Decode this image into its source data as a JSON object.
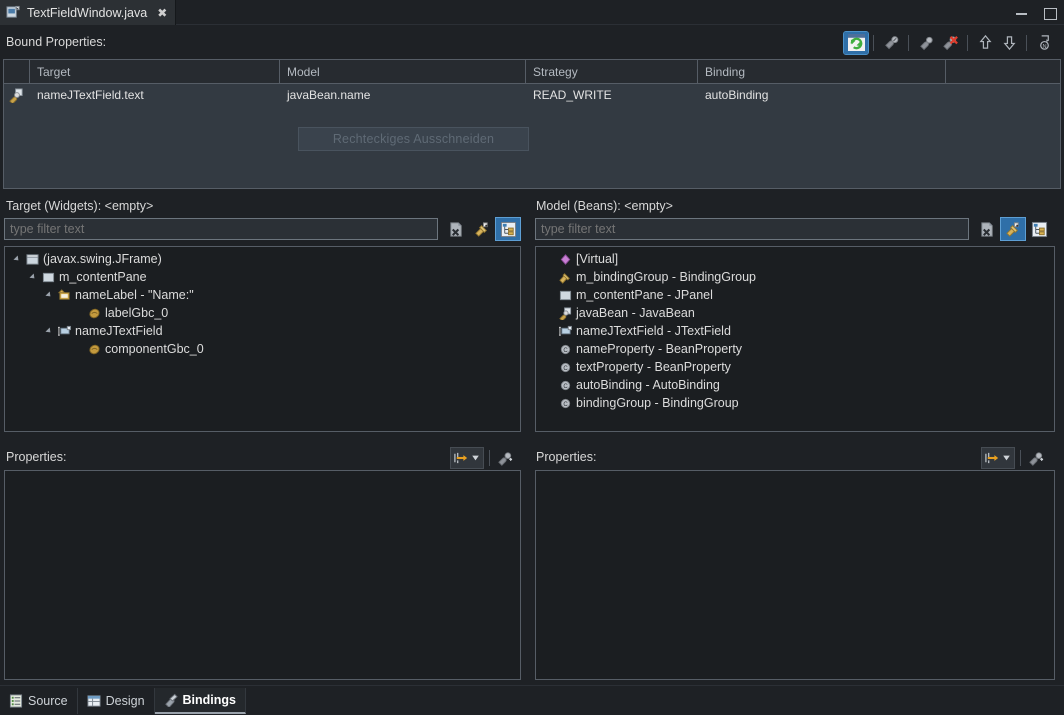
{
  "window": {
    "editor_tab_label": "TextFieldWindow.java",
    "tab_close_glyph": "✖",
    "minimize_label": "Minimize",
    "maximize_label": "Maximize"
  },
  "bound_properties": {
    "label": "Bound Properties:",
    "toolbar": [
      {
        "name": "refresh-bindings-button",
        "tooltip": "Refresh",
        "active": true
      },
      {
        "name": "edit-binding-button",
        "tooltip": "Edit Binding",
        "active": false
      },
      {
        "name": "add-binding-button",
        "tooltip": "Add Binding",
        "active": false
      },
      {
        "name": "delete-binding-button",
        "tooltip": "Delete Binding",
        "active": false
      },
      {
        "name": "move-up-button",
        "tooltip": "Move Up",
        "active": false
      },
      {
        "name": "move-down-button",
        "tooltip": "Move Down",
        "active": false
      },
      {
        "name": "goto-definition-button",
        "tooltip": "Go To Definition",
        "active": false
      }
    ],
    "columns": [
      "Target",
      "Model",
      "Strategy",
      "Binding"
    ],
    "rows": [
      {
        "icon": "binding-icon",
        "target": "nameJTextField.text",
        "model": "javaBean.name",
        "strategy": "READ_WRITE",
        "binding": "autoBinding"
      }
    ],
    "overlay_tooltip": "Rechteckiges Ausschneiden"
  },
  "target_panel": {
    "label": "Target (Widgets): <empty>",
    "filter": {
      "value": "type filter text",
      "placeholder": "type filter text"
    },
    "filter_buttons": [
      {
        "name": "clear-filter-icon",
        "selected": false
      },
      {
        "name": "show-properties-icon",
        "selected": false
      },
      {
        "name": "show-tree-icon",
        "selected": true
      }
    ],
    "tree": [
      {
        "indent": 0,
        "twisty": true,
        "icon": "frame-icon",
        "label": "(javax.swing.JFrame)"
      },
      {
        "indent": 1,
        "twisty": true,
        "icon": "panel-icon",
        "label": "m_contentPane"
      },
      {
        "indent": 2,
        "twisty": true,
        "icon": "label-icon",
        "label": "nameLabel - \"Name:\""
      },
      {
        "indent": 3,
        "twisty": false,
        "icon": "bean-icon",
        "label": "labelGbc_0"
      },
      {
        "indent": 2,
        "twisty": true,
        "icon": "textfield-icon",
        "label": "nameJTextField"
      },
      {
        "indent": 3,
        "twisty": false,
        "icon": "bean-icon",
        "label": "componentGbc_0"
      }
    ],
    "properties": {
      "label": "Properties:",
      "buttons": [
        {
          "name": "show-advanced-properties-icon",
          "dropdown": true
        },
        {
          "name": "goto-property-definition-icon",
          "dropdown": false
        }
      ],
      "rows": []
    }
  },
  "model_panel": {
    "label": "Model (Beans): <empty>",
    "filter": {
      "value": "type filter text",
      "placeholder": "type filter text"
    },
    "filter_buttons": [
      {
        "name": "clear-filter-icon",
        "selected": false
      },
      {
        "name": "show-properties-icon",
        "selected": true
      },
      {
        "name": "show-tree-icon",
        "selected": false
      }
    ],
    "tree": [
      {
        "indent": 0,
        "twisty": false,
        "icon": "virtual-icon",
        "label": "[Virtual]"
      },
      {
        "indent": 0,
        "twisty": false,
        "icon": "bindinggroup-icon",
        "label": "m_bindingGroup - BindingGroup"
      },
      {
        "indent": 0,
        "twisty": false,
        "icon": "panel-icon",
        "label": "m_contentPane - JPanel"
      },
      {
        "indent": 0,
        "twisty": false,
        "icon": "javabean-icon",
        "label": "javaBean - JavaBean"
      },
      {
        "indent": 0,
        "twisty": false,
        "icon": "textfield-icon",
        "label": "nameJTextField - JTextField"
      },
      {
        "indent": 0,
        "twisty": false,
        "icon": "property-icon",
        "label": "nameProperty - BeanProperty"
      },
      {
        "indent": 0,
        "twisty": false,
        "icon": "property-icon",
        "label": "textProperty - BeanProperty"
      },
      {
        "indent": 0,
        "twisty": false,
        "icon": "property-icon",
        "label": "autoBinding - AutoBinding"
      },
      {
        "indent": 0,
        "twisty": false,
        "icon": "property-icon",
        "label": "bindingGroup - BindingGroup"
      }
    ],
    "properties": {
      "label": "Properties:",
      "buttons": [
        {
          "name": "show-advanced-properties-icon",
          "dropdown": true
        },
        {
          "name": "goto-property-definition-icon",
          "dropdown": false
        }
      ],
      "rows": []
    }
  },
  "bottom_tabs": [
    {
      "name": "tab-source",
      "label": "Source",
      "icon": "source-icon",
      "active": false
    },
    {
      "name": "tab-design",
      "label": "Design",
      "icon": "design-icon",
      "active": false
    },
    {
      "name": "tab-bindings",
      "label": "Bindings",
      "icon": "bindings-icon",
      "active": true
    }
  ],
  "colors": {
    "background": "#1e2125",
    "panel": "#1b1e21",
    "table_body": "#333a42",
    "table_header": "#272b30",
    "border": "#565d66",
    "accent_selected": "#2f6fa8",
    "text": "#dcdcdc"
  }
}
